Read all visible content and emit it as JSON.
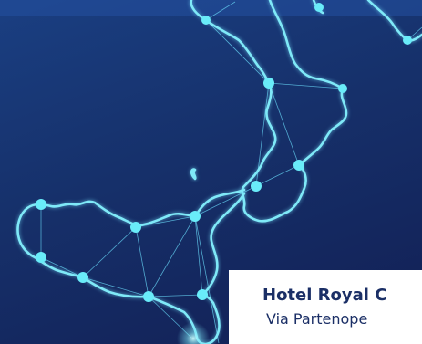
{
  "hotel_card": {
    "title": "Hotel Royal C",
    "address": "Via Partenope"
  },
  "colors": {
    "background": "#16306a",
    "coastline": "#7fe9f8",
    "node": "#69ecf9",
    "card_text": "#1b2f66"
  }
}
